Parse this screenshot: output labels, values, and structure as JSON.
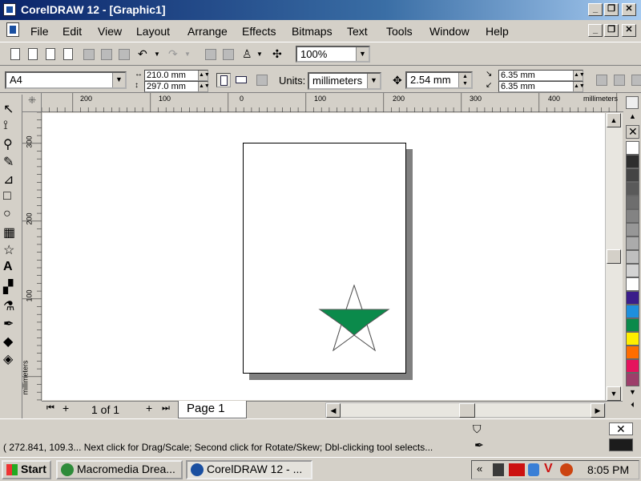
{
  "window": {
    "title": "CorelDRAW 12 - [Graphic1]"
  },
  "menu": [
    "File",
    "Edit",
    "View",
    "Layout",
    "Arrange",
    "Effects",
    "Bitmaps",
    "Text",
    "Tools",
    "Window",
    "Help"
  ],
  "toolbar": {
    "zoom": "100%"
  },
  "property_bar": {
    "paper_size": "A4",
    "width": "210.0 mm",
    "height": "297.0 mm",
    "units_label": "Units:",
    "units": "millimeters",
    "nudge": "2.54 mm",
    "dup_x": "6.35 mm",
    "dup_y": "6.35 mm"
  },
  "ruler": {
    "unit": "millimeters",
    "h_labels": [
      "200",
      "100",
      "0",
      "100",
      "200",
      "300",
      "400"
    ],
    "v_labels": [
      "300",
      "200",
      "100"
    ]
  },
  "page_nav": {
    "count": "1 of 1",
    "tab": "Page 1"
  },
  "status": {
    "text": "( 272.841, 109.3... Next click for Drag/Scale; Second click for Rotate/Skew; Dbl-clicking tool selects..."
  },
  "taskbar": {
    "start": "Start",
    "tasks": [
      "Macromedia Drea...",
      "CorelDRAW 12 - ..."
    ],
    "time": "8:05 PM"
  },
  "colors": {
    "star_fill": "#0b8a4b",
    "palette": [
      "#ffffff",
      "#2e2e2e",
      "#444444",
      "#5a5a5a",
      "#6e6e6e",
      "#838383",
      "#979797",
      "#ababab",
      "#bfbfbf",
      "#d3d3d3",
      "#ffffff",
      "#3a1d8a",
      "#1e8fdc",
      "#0b8a4b",
      "#ffee00",
      "#ff6d00",
      "#e5135d",
      "#9d3e6a"
    ]
  }
}
